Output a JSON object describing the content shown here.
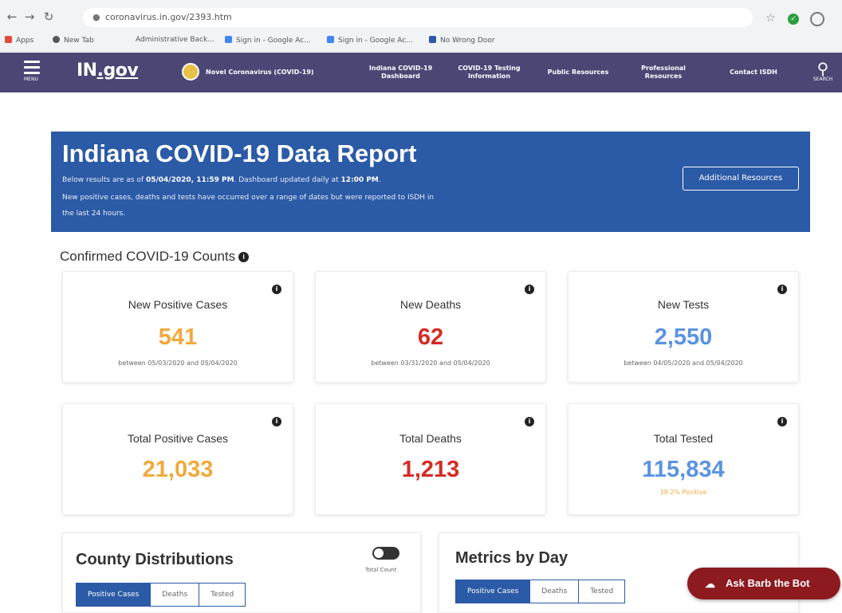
{
  "browser": {
    "url": "coronavirus.in.gov/2393.htm",
    "bookmarks": [
      "Apps",
      "New Tab",
      "Administrative Back...",
      "Sign in - Google Ac...",
      "Sign in - Google Ac...",
      "No Wrong Door"
    ]
  },
  "header": {
    "menu_label": "MENU",
    "logo": "IN",
    "logo_suffix": ".gov",
    "nav": [
      {
        "label": "Novel Coronavirus (COVID-19)"
      },
      {
        "label": "Indiana COVID-19 Dashboard"
      },
      {
        "label": "COVID-19 Testing Information"
      },
      {
        "label": "Public Resources"
      },
      {
        "label": "Professional Resources"
      },
      {
        "label": "Contact ISDH"
      }
    ],
    "search_label": "SEARCH"
  },
  "hero": {
    "title": "Indiana COVID-19 Data Report",
    "line1_pre": "Below results are as of ",
    "line1_date": "05/04/2020, 11:59 PM",
    "line1_mid": ". Dashboard updated daily at ",
    "line1_time": "12:00 PM",
    "line1_end": ".",
    "line2": "New positive cases, deaths and tests have occurred over a range of dates but were reported to ISDH in",
    "line3": "the last 24 hours.",
    "button": "Additional Resources"
  },
  "counts": {
    "title": "Confirmed COVID-19 Counts",
    "cards": [
      {
        "title": "New Positive Cases",
        "value": "541",
        "sub": "between 05/03/2020 and 05/04/2020",
        "color": "#f2a93b"
      },
      {
        "title": "New Deaths",
        "value": "62",
        "sub": "between 03/31/2020 and 05/04/2020",
        "color": "#d62a24"
      },
      {
        "title": "New Tests",
        "value": "2,550",
        "sub": "between 04/05/2020 and 05/04/2020",
        "color": "#5b93e3"
      },
      {
        "title": "Total Positive Cases",
        "value": "21,033",
        "sub": "",
        "color": "#f2a93b"
      },
      {
        "title": "Total Deaths",
        "value": "1,213",
        "sub": "",
        "color": "#d62a24"
      },
      {
        "title": "Total Tested",
        "value": "115,834",
        "sub": "18.2% Positive",
        "color": "#5b93e3"
      }
    ]
  },
  "county": {
    "title": "County Distributions",
    "tabs": [
      "Positive Cases",
      "Deaths",
      "Tested"
    ],
    "toggle_label": "Total Count"
  },
  "metrics": {
    "title": "Metrics by Day",
    "tabs": [
      "Positive Cases",
      "Deaths",
      "Tested"
    ]
  },
  "bot": {
    "label": "Ask Barb the Bot"
  }
}
